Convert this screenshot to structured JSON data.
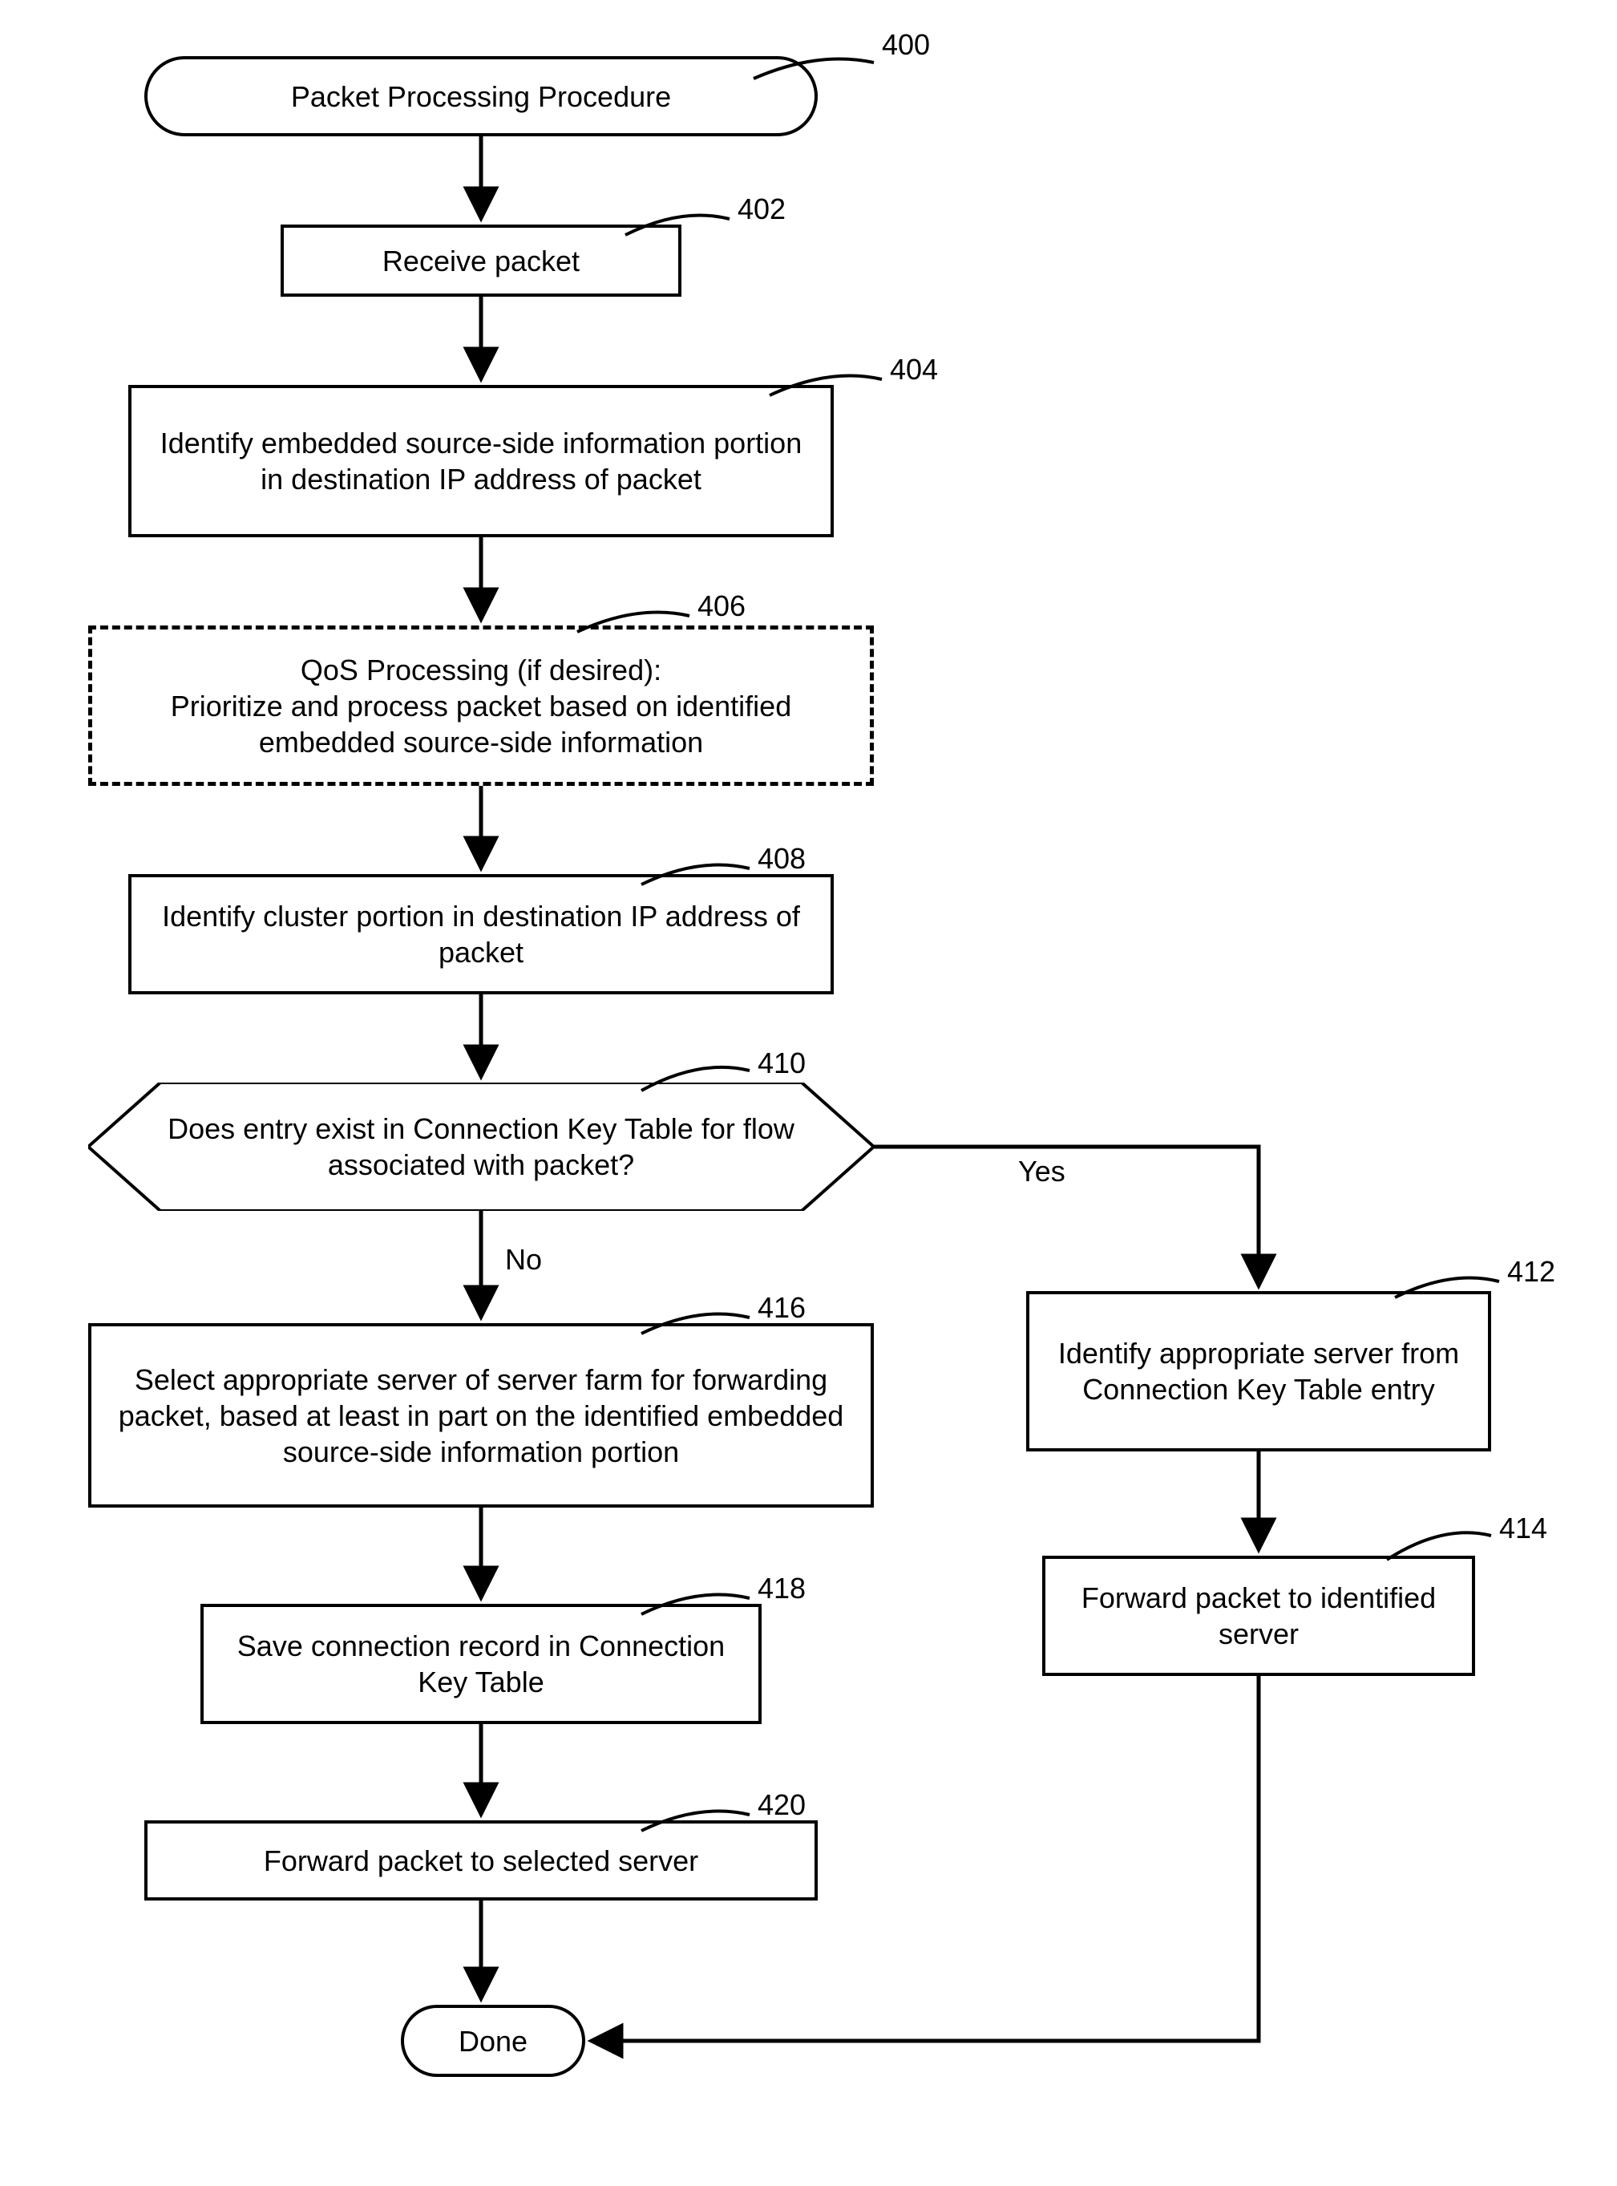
{
  "chart_data": {
    "type": "flowchart",
    "nodes": [
      {
        "id": "400",
        "shape": "terminator",
        "text": "Packet Processing Procedure"
      },
      {
        "id": "402",
        "shape": "process",
        "text": "Receive packet"
      },
      {
        "id": "404",
        "shape": "process",
        "text": "Identify embedded source-side information portion in destination IP address of packet"
      },
      {
        "id": "406",
        "shape": "process-dashed",
        "text": "QoS Processing (if desired):\nPrioritize and process packet based on identified embedded source-side information"
      },
      {
        "id": "408",
        "shape": "process",
        "text": "Identify cluster portion in destination IP address of packet"
      },
      {
        "id": "410",
        "shape": "decision",
        "text": "Does entry exist in Connection Key Table for flow associated with packet?"
      },
      {
        "id": "412",
        "shape": "process",
        "text": "Identify appropriate server from Connection Key Table entry"
      },
      {
        "id": "414",
        "shape": "process",
        "text": "Forward packet to identified server"
      },
      {
        "id": "416",
        "shape": "process",
        "text": "Select appropriate server of server farm for forwarding packet, based at least in part on the identified embedded source-side information portion"
      },
      {
        "id": "418",
        "shape": "process",
        "text": "Save connection record in Connection Key Table"
      },
      {
        "id": "420",
        "shape": "process",
        "text": "Forward packet to selected server"
      },
      {
        "id": "done",
        "shape": "terminator",
        "text": "Done"
      }
    ],
    "edges": [
      {
        "from": "400",
        "to": "402"
      },
      {
        "from": "402",
        "to": "404"
      },
      {
        "from": "404",
        "to": "406"
      },
      {
        "from": "406",
        "to": "408"
      },
      {
        "from": "408",
        "to": "410"
      },
      {
        "from": "410",
        "to": "416",
        "label": "No"
      },
      {
        "from": "410",
        "to": "412",
        "label": "Yes"
      },
      {
        "from": "412",
        "to": "414"
      },
      {
        "from": "416",
        "to": "418"
      },
      {
        "from": "418",
        "to": "420"
      },
      {
        "from": "420",
        "to": "done"
      },
      {
        "from": "414",
        "to": "done"
      }
    ]
  },
  "refs": {
    "n400": "400",
    "n402": "402",
    "n404": "404",
    "n406": "406",
    "n408": "408",
    "n410": "410",
    "n412": "412",
    "n414": "414",
    "n416": "416",
    "n418": "418",
    "n420": "420"
  },
  "edgeLabels": {
    "no": "No",
    "yes": "Yes"
  },
  "text": {
    "t400": "Packet Processing Procedure",
    "t402": "Receive packet",
    "t404": "Identify embedded source-side information portion in destination IP address of packet",
    "t406a": "QoS Processing (if desired):",
    "t406b": "Prioritize and process packet based on identified embedded source-side information",
    "t408": "Identify cluster portion in destination IP address of packet",
    "t410": "Does entry exist in Connection Key Table for flow associated with packet?",
    "t412": "Identify appropriate server from Connection Key Table entry",
    "t414": "Forward packet to identified server",
    "t416": "Select appropriate server of server farm for forwarding packet, based at least in part on the identified embedded source-side information portion",
    "t418": "Save connection record in Connection Key Table",
    "t420": "Forward packet to selected server",
    "tdone": "Done"
  }
}
